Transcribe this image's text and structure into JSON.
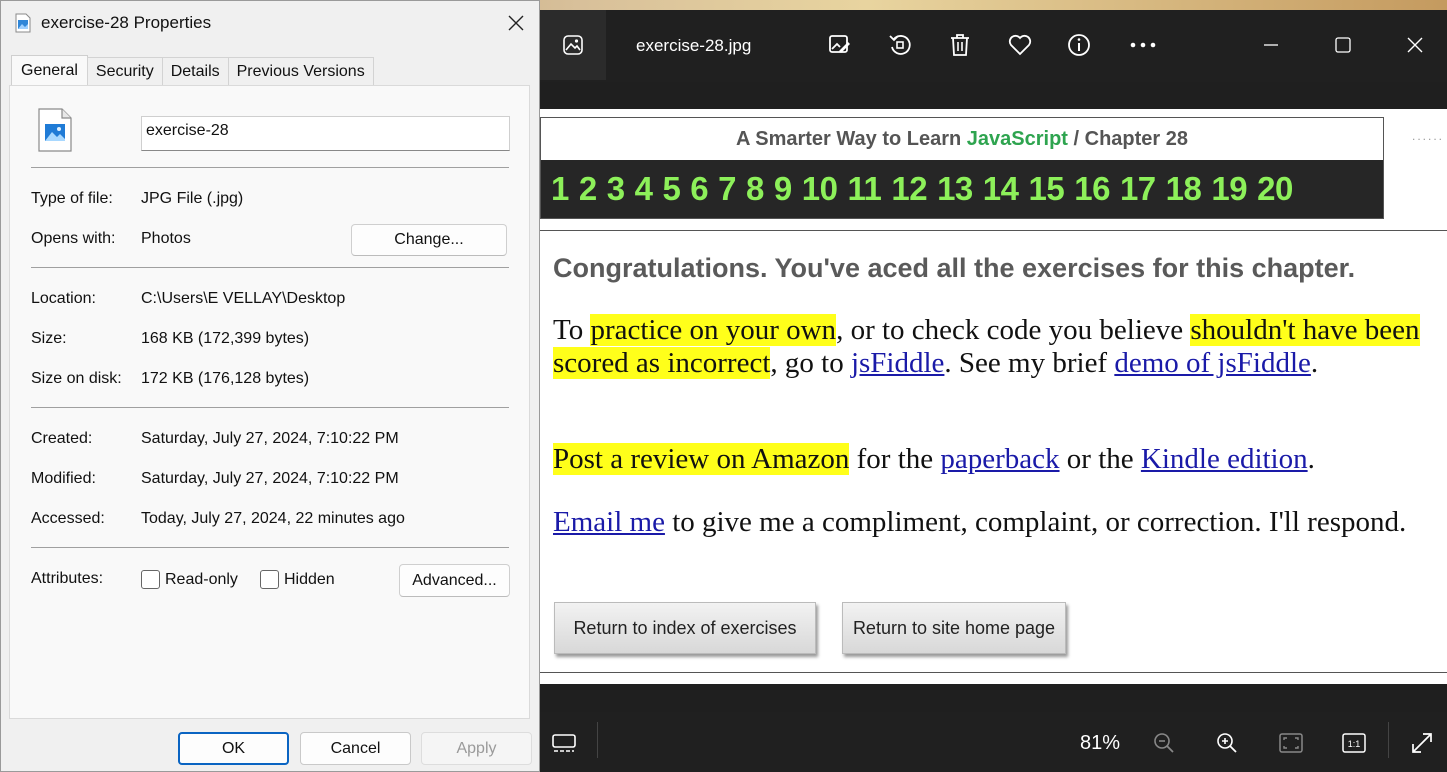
{
  "dialog": {
    "title": "exercise-28 Properties",
    "tabs": [
      {
        "label": "General",
        "active": true
      },
      {
        "label": "Security",
        "active": false
      },
      {
        "label": "Details",
        "active": false
      },
      {
        "label": "Previous Versions",
        "active": false
      }
    ],
    "file_name": "exercise-28",
    "type_label": "Type of file:",
    "type_value": "JPG File (.jpg)",
    "opens_label": "Opens with:",
    "opens_value": "Photos",
    "change_button": "Change...",
    "location_label": "Location:",
    "location_value": "C:\\Users\\E VELLAY\\Desktop",
    "size_label": "Size:",
    "size_value": "168 KB (172,399 bytes)",
    "size_disk_label": "Size on disk:",
    "size_disk_value": "172 KB (176,128 bytes)",
    "created_label": "Created:",
    "created_value": "Saturday, July 27, 2024, 7:10:22 PM",
    "modified_label": "Modified:",
    "modified_value": "Saturday, July 27, 2024, 7:10:22 PM",
    "accessed_label": "Accessed:",
    "accessed_value": "Today, July 27, 2024, 22 minutes ago",
    "attributes_label": "Attributes:",
    "readonly_label": "Read-only",
    "hidden_label": "Hidden",
    "advanced_button": "Advanced...",
    "ok_button": "OK",
    "cancel_button": "Cancel",
    "apply_button": "Apply"
  },
  "photos": {
    "filename": "exercise-28.jpg",
    "zoom": "81%",
    "toolbar_icons": [
      "edit-image-icon",
      "rotate-icon",
      "delete-icon",
      "favorite-icon",
      "info-icon",
      "more-icon"
    ],
    "window_icons": [
      "minimize-icon",
      "maximize-icon",
      "close-icon"
    ],
    "bottom_icons": [
      "filmstrip-icon",
      "zoom-out-icon",
      "zoom-in-icon",
      "fit-screen-icon",
      "actual-size-icon",
      "fullscreen-icon"
    ]
  },
  "image": {
    "title_prefix": "A Smarter Way to Learn ",
    "title_js": "JavaScript",
    "title_suffix": " / Chapter 28",
    "chapters": [
      "1",
      "2",
      "3",
      "4",
      "5",
      "6",
      "7",
      "8",
      "9",
      "10",
      "11",
      "12",
      "13",
      "14",
      "15",
      "16",
      "17",
      "18",
      "19",
      "20"
    ],
    "congrats": "Congratulations. You've aced all the exercises for this chapter.",
    "p1_a": "To ",
    "p1_hl1": "practice on your own",
    "p1_b": ", or to check code you believe ",
    "p1_hl2": "shouldn't have been scored as incorrect",
    "p1_c": ", go to ",
    "p1_link1": "jsFiddle",
    "p1_d": ". See my brief ",
    "p1_link2": "demo of jsFiddle",
    "p1_e": ".",
    "p2_hl": "Post a review on Amazon",
    "p2_a": " for the ",
    "p2_link1": "paperback",
    "p2_b": " or the ",
    "p2_link2": "Kindle edition",
    "p2_c": ".",
    "p3_link": "Email me",
    "p3_a": " to give me a compliment, complaint, or correction. I'll respond.",
    "btn_index": "Return to index of exercises",
    "btn_home": "Return to site home page"
  }
}
